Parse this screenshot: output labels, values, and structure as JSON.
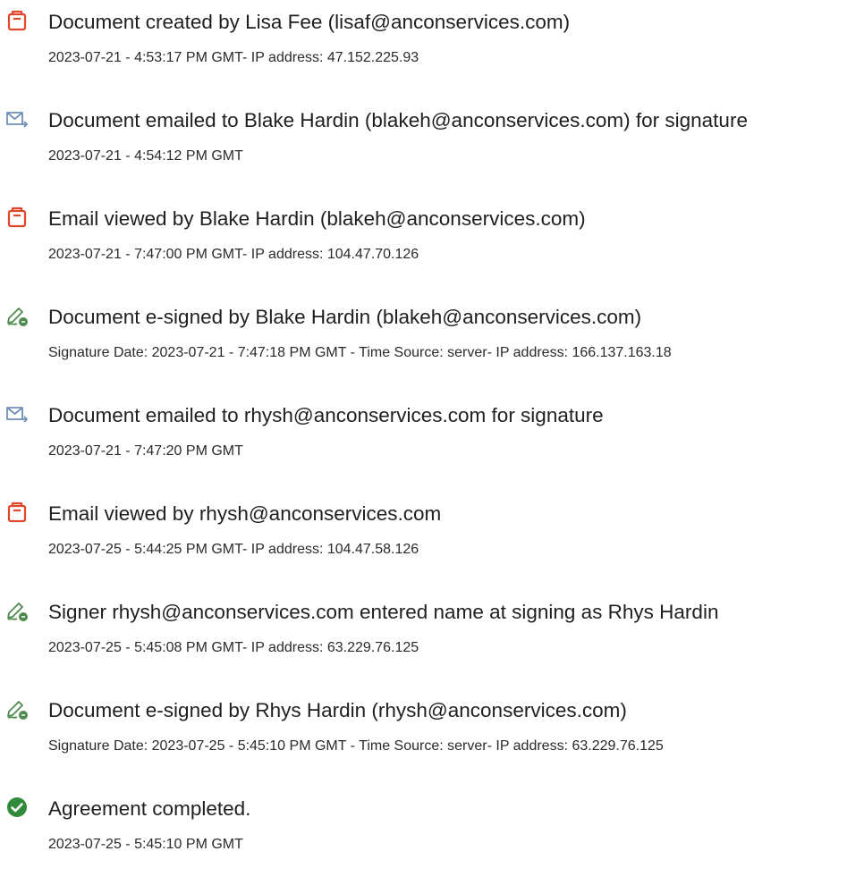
{
  "events": [
    {
      "icon": "document-created-icon",
      "title": "Document created by Lisa Fee (lisaf@anconservices.com)",
      "detail": "2023-07-21 - 4:53:17 PM GMT- IP address: 47.152.225.93"
    },
    {
      "icon": "email-sent-icon",
      "title": "Document emailed to Blake Hardin (blakeh@anconservices.com) for signature",
      "detail": "2023-07-21 - 4:54:12 PM GMT"
    },
    {
      "icon": "email-viewed-icon",
      "title": "Email viewed by Blake Hardin (blakeh@anconservices.com)",
      "detail": "2023-07-21 - 7:47:00 PM GMT- IP address: 104.47.70.126"
    },
    {
      "icon": "e-sign-pen-icon",
      "title": "Document e-signed by Blake Hardin (blakeh@anconservices.com)",
      "detail": "Signature Date: 2023-07-21 - 7:47:18 PM GMT - Time Source: server- IP address: 166.137.163.18"
    },
    {
      "icon": "email-sent-icon",
      "title": "Document emailed to rhysh@anconservices.com for signature",
      "detail": "2023-07-21 - 7:47:20 PM GMT"
    },
    {
      "icon": "email-viewed-icon",
      "title": "Email viewed by rhysh@anconservices.com",
      "detail": "2023-07-25 - 5:44:25 PM GMT- IP address: 104.47.58.126"
    },
    {
      "icon": "e-sign-pen-icon",
      "title": "Signer rhysh@anconservices.com entered name at signing as Rhys Hardin",
      "detail": "2023-07-25 - 5:45:08 PM GMT- IP address: 63.229.76.125"
    },
    {
      "icon": "e-sign-pen-icon",
      "title": "Document e-signed by Rhys Hardin (rhysh@anconservices.com)",
      "detail": "Signature Date: 2023-07-25 - 5:45:10 PM GMT - Time Source: server- IP address: 63.229.76.125"
    },
    {
      "icon": "check-circle-icon",
      "title": "Agreement completed.",
      "detail": "2023-07-25 - 5:45:10 PM GMT"
    }
  ],
  "colors": {
    "document_icon": "#e0472b",
    "email_icon": "#6f8fb8",
    "sign_icon": "#4f8a4f",
    "check_icon": "#2f8a3c"
  }
}
